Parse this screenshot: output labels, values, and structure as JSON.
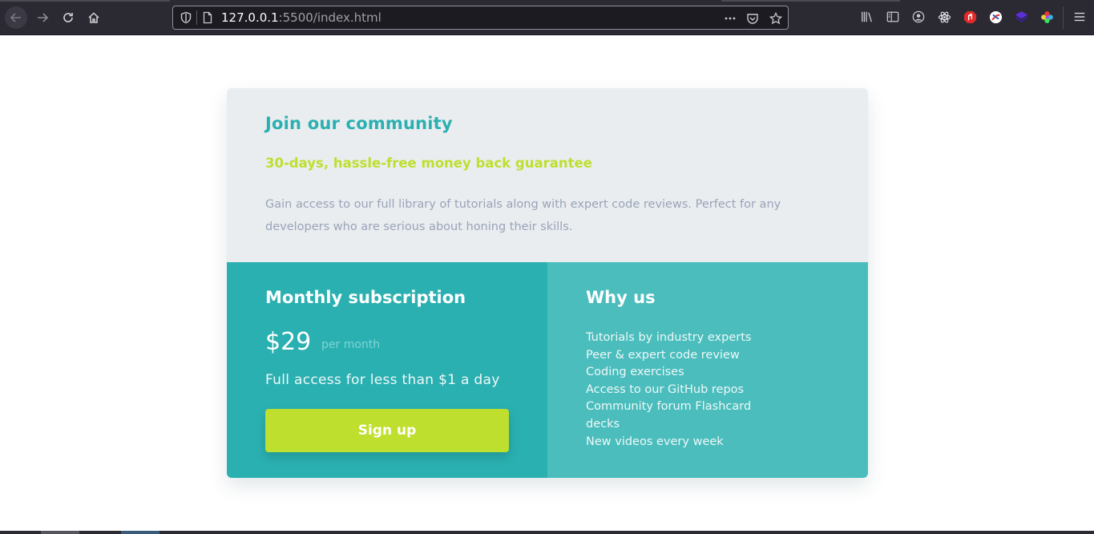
{
  "browser": {
    "url_host": "127.0.0.1",
    "url_rest": ":5500/index.html",
    "icons": [
      "back-arrow-icon",
      "forward-arrow-icon",
      "reload-icon",
      "home-icon",
      "shield-icon",
      "page-icon",
      "more-icon",
      "pocket-icon",
      "star-icon",
      "library-icon",
      "sidebar-icon",
      "account-icon",
      "react-devtools-icon",
      "adblock-icon",
      "extension-icon",
      "extension-icon",
      "colorpicker-icon",
      "menu-icon"
    ]
  },
  "card": {
    "top": {
      "title": "Join our community",
      "guarantee": "30-days, hassle-free money back guarantee",
      "description": "Gain access to our full library of tutorials along with expert code reviews. Perfect for any developers who are serious about honing their skills."
    },
    "subscription": {
      "title": "Monthly subscription",
      "price": "$29",
      "period": "per month",
      "tagline": "Full access for less than $1 a day",
      "button_label": "Sign up"
    },
    "why_us": {
      "title": "Why us",
      "items": [
        "Tutorials by industry experts",
        "Peer & expert code review",
        "Coding exercises",
        "Access to our GitHub repos",
        "Community forum Flashcard decks",
        "New videos every week"
      ]
    }
  },
  "colors": {
    "cyan": "#2bb0b1",
    "light_cyan": "#4bbdbd",
    "lime": "#bfdf2e",
    "gray_bg": "#e9edf0",
    "grayish_blue": "#9aa3b8"
  }
}
